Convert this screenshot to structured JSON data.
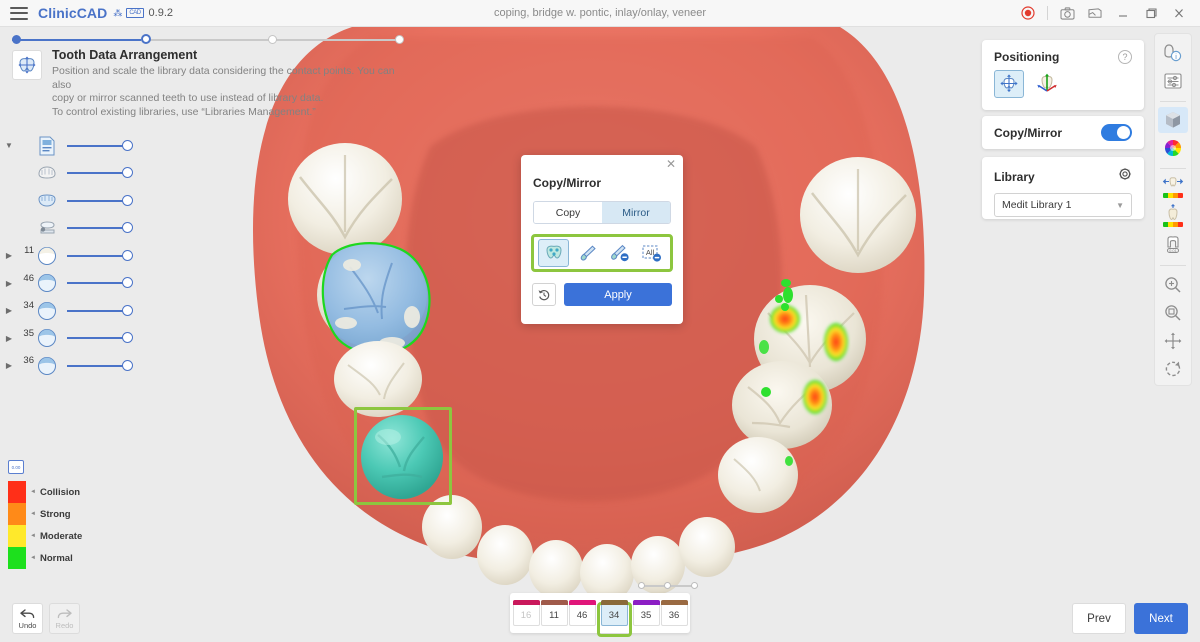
{
  "titlebar": {
    "menu_icon": "hamburger-icon",
    "brand": "ClinicCAD",
    "version": "0.9.2",
    "subtitle": "coping, bridge w. pontic, inlay/onlay, veneer",
    "buttons": [
      {
        "name": "record-button",
        "icon": "record-icon",
        "label": "◉"
      },
      {
        "name": "screenshot-button",
        "icon": "camera-icon",
        "label": "❐"
      },
      {
        "name": "gallery-button",
        "icon": "image-icon",
        "label": "❑"
      },
      {
        "name": "minimize-button",
        "icon": "minimize-icon",
        "label": "—"
      },
      {
        "name": "maximize-button",
        "icon": "maximize-icon",
        "label": "❐"
      },
      {
        "name": "close-button",
        "icon": "close-icon",
        "label": "✕"
      }
    ]
  },
  "steps": {
    "total": 4,
    "current_index": 1,
    "dots": [
      {
        "state": "done",
        "pos": 0
      },
      {
        "state": "current",
        "pos": 129
      },
      {
        "state": "todo",
        "pos": 256
      },
      {
        "state": "todo",
        "pos": 383
      }
    ]
  },
  "info": {
    "icon": "tooth-arrange-icon",
    "title": "Tooth Data Arrangement",
    "desc_line1": "Position and scale the library data considering the contact points. You can also",
    "desc_line2": "copy or mirror scanned teeth to use instead of library data.",
    "desc_line3": "To control existing libraries, use “Libraries Management.”"
  },
  "left_list": {
    "rows": [
      {
        "name": "row-all-data",
        "caret": "down",
        "num": "",
        "icon": "document-layers-icon",
        "slider_value": 86
      },
      {
        "name": "row-upper-jaw",
        "caret": "",
        "num": "",
        "icon": "upper-jaw-icon",
        "slider_value": 86
      },
      {
        "name": "row-lower-jaw",
        "caret": "",
        "num": "",
        "icon": "lower-jaw-icon",
        "slider_value": 86
      },
      {
        "name": "row-occlusion",
        "caret": "",
        "num": "",
        "icon": "occlusion-icon",
        "slider_value": 86
      },
      {
        "name": "row-tooth-11",
        "caret": "right",
        "num": "11",
        "icon": "tooth-crown-icon",
        "slider_value": 86
      },
      {
        "name": "row-tooth-46",
        "caret": "right",
        "num": "46",
        "icon": "tooth-crown-icon",
        "slider_value": 86
      },
      {
        "name": "row-tooth-34",
        "caret": "right",
        "num": "34",
        "icon": "tooth-crown-icon",
        "slider_value": 86
      },
      {
        "name": "row-tooth-35",
        "caret": "right",
        "num": "35",
        "icon": "tooth-crown-icon",
        "slider_value": 86
      },
      {
        "name": "row-tooth-36",
        "caret": "right",
        "num": "36",
        "icon": "tooth-crown-icon",
        "slider_value": 86
      }
    ]
  },
  "legend": {
    "scale_label": "0.00",
    "items": [
      {
        "label": "Collision",
        "color": "#ff2f18"
      },
      {
        "label": "Strong",
        "color": "#ff8a18"
      },
      {
        "label": "Moderate",
        "color": "#ffe92b"
      },
      {
        "label": "Normal",
        "color": "#1de01d"
      }
    ]
  },
  "dialog": {
    "title": "Copy/Mirror",
    "close_label": "✕",
    "tabs": [
      {
        "label": "Copy",
        "selected": false
      },
      {
        "label": "Mirror",
        "selected": true
      }
    ],
    "tools": [
      {
        "name": "select-tooth-tool",
        "icon": "tooth-select-icon",
        "selected": true
      },
      {
        "name": "brush-add-tool",
        "icon": "brush-icon",
        "selected": false
      },
      {
        "name": "brush-remove-tool",
        "icon": "brush-minus-icon",
        "selected": false
      },
      {
        "name": "deselect-all-tool",
        "icon": "all-minus-icon",
        "selected": false,
        "label": "All"
      }
    ],
    "history_icon": "history-revert-icon",
    "apply_label": "Apply"
  },
  "right_panels": {
    "positioning": {
      "title": "Positioning",
      "help_icon": "help-icon",
      "tools": [
        {
          "name": "free-move-tool",
          "icon": "free-move-icon",
          "selected": true
        },
        {
          "name": "axis-move-tool",
          "icon": "axis-gizmo-icon",
          "selected": false
        }
      ]
    },
    "copy_mirror": {
      "title": "Copy/Mirror",
      "toggle_on": true,
      "accent": "#2f7ce0"
    },
    "library": {
      "title": "Library",
      "settings_icon": "gear-icon",
      "selected_value": "Medit Library 1",
      "chevron": "⌄"
    }
  },
  "right_toolbar": {
    "buttons": [
      {
        "name": "tool-info",
        "icon": "magnifier-info-icon",
        "selected": false
      },
      {
        "name": "tool-settings",
        "icon": "sliders-icon",
        "selected": false
      },
      {
        "name": "tool-model-view",
        "icon": "cube-icon",
        "selected": true
      },
      {
        "name": "tool-color-wheel",
        "icon": "color-wheel-icon",
        "selected": false
      },
      {
        "name": "tool-contact-map",
        "icon": "tooth-contact-icon",
        "selected": false
      },
      {
        "name": "tool-occlusion",
        "icon": "tooth-occlusion-icon",
        "selected": false
      },
      {
        "name": "tool-margin",
        "icon": "tooth-margin-icon",
        "selected": false
      },
      {
        "name": "tool-zoom-in",
        "icon": "zoom-in-icon",
        "selected": false
      },
      {
        "name": "tool-zoom-fit",
        "icon": "zoom-fit-icon",
        "selected": false
      },
      {
        "name": "tool-pan",
        "icon": "pan-move-icon",
        "selected": false
      },
      {
        "name": "tool-rotate",
        "icon": "rotate-icon",
        "selected": false
      }
    ]
  },
  "bottom": {
    "undo": {
      "label": "Undo",
      "icon": "undo-arrow-icon",
      "enabled": true
    },
    "redo": {
      "label": "Redo",
      "icon": "redo-arrow-icon",
      "enabled": false
    },
    "teeth": [
      {
        "number": "16",
        "color": "#c9185b",
        "selected": false,
        "dim": true
      },
      {
        "number": "11",
        "color": "#a05a4a",
        "selected": false,
        "dim": false
      },
      {
        "number": "46",
        "color": "#e0167a",
        "selected": false,
        "dim": false
      },
      {
        "number": "34",
        "color": "#8a6a3a",
        "selected": true,
        "dim": false
      },
      {
        "number": "35",
        "color": "#8c1ec4",
        "selected": false,
        "dim": false
      },
      {
        "number": "36",
        "color": "#9a6a42",
        "selected": false,
        "dim": false
      }
    ],
    "prev_label": "Prev",
    "next_label": "Next",
    "next_accent": "#3b72d9"
  }
}
